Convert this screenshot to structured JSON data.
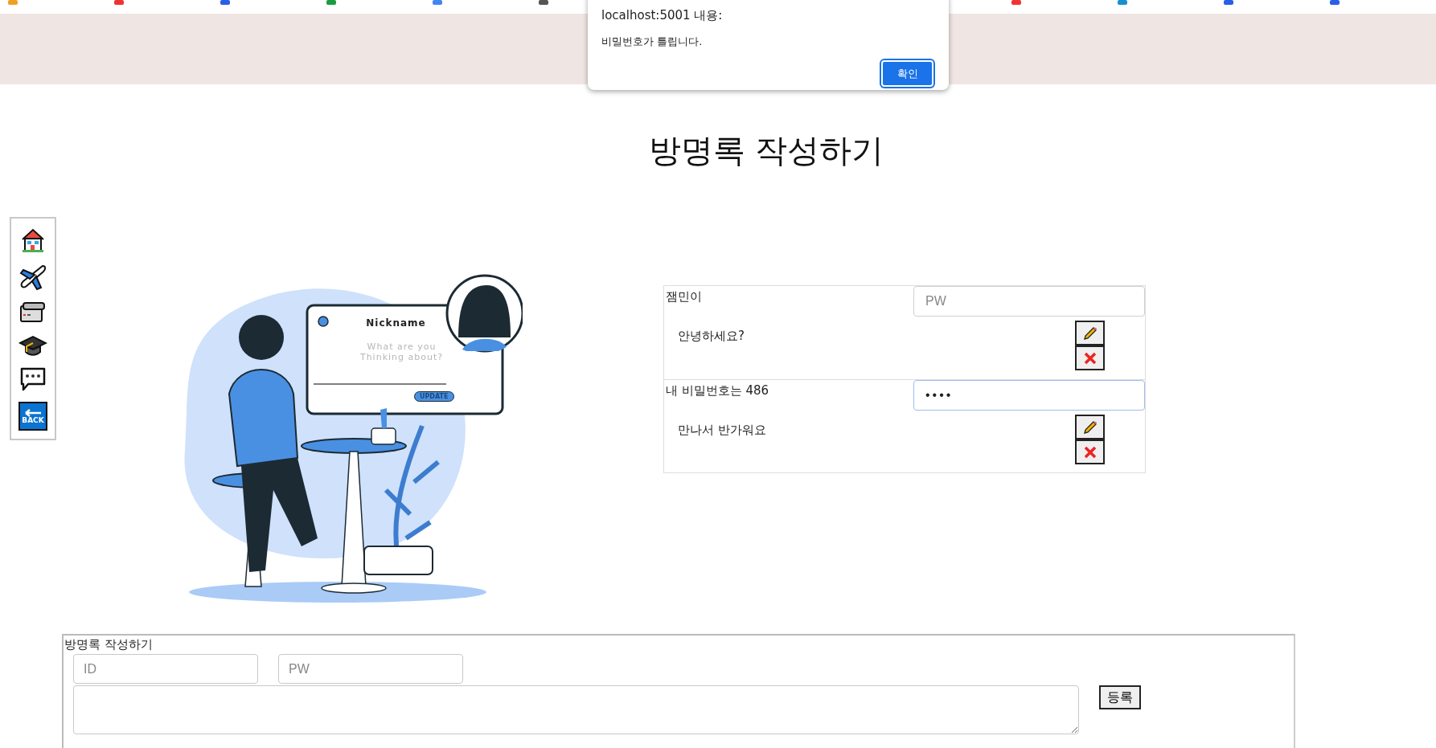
{
  "page_title": "방명록 작성하기",
  "sidebar": [
    {
      "kind": "home"
    },
    {
      "kind": "plane"
    },
    {
      "kind": "camcorder"
    },
    {
      "kind": "cap"
    },
    {
      "kind": "chat"
    },
    {
      "kind": "back",
      "label": "BACK"
    }
  ],
  "illustration": {
    "card_title": "Nickname",
    "card_placeholder": "What are you Thinking about?",
    "card_button": "UPDATE"
  },
  "entries": [
    {
      "author": "잼민이",
      "password": {
        "placeholder": "PW",
        "focused": false
      },
      "message": "안녕하세요?"
    },
    {
      "author": "내 비밀번호는 486",
      "password": {
        "value": "••••",
        "focused": true
      },
      "message": "만나서 반가워요"
    }
  ],
  "write_form": {
    "title": "방명록 작성하기",
    "id_placeholder": "ID",
    "pw_placeholder": "PW",
    "submit": "등록"
  },
  "alert": {
    "title": "localhost:5001 내용:",
    "message": "비밀번호가 틀립니다.",
    "ok": "확인"
  }
}
